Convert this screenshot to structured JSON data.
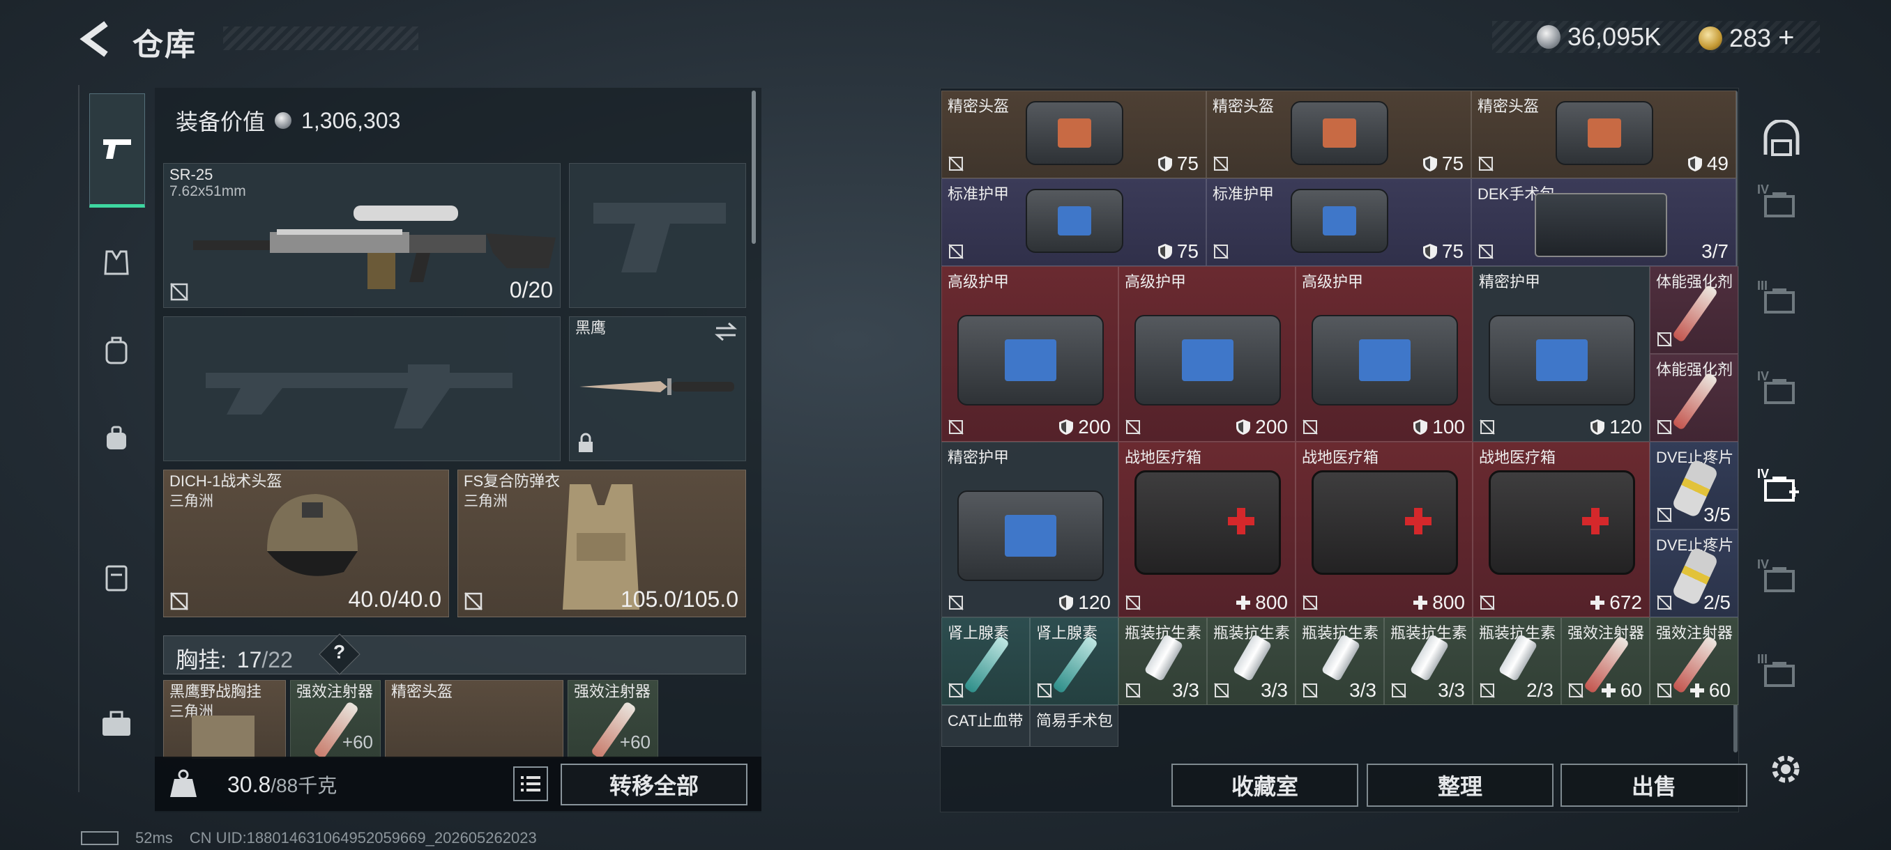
{
  "header": {
    "title": "仓库",
    "currency_silver": "36,095K",
    "currency_gold": "283",
    "gold_plus": "+"
  },
  "equipment": {
    "value_label": "装备价值",
    "value": "1,306,303"
  },
  "slots": {
    "primary": {
      "name": "SR-25",
      "caliber": "7.62x51mm",
      "ammo": "0/20"
    },
    "melee": {
      "name": "黑鹰"
    },
    "helmet": {
      "name": "DICH-1战术头盔",
      "brand": "三角洲",
      "durability": "40.0/40.0"
    },
    "armor": {
      "name": "FS复合防弹衣",
      "brand": "三角洲",
      "durability": "105.0/105.0"
    }
  },
  "chest_rig": {
    "label": "胸挂:",
    "used": "17",
    "capacity": "/22",
    "help": "?",
    "items": [
      {
        "name": "黑鹰野战胸挂",
        "brand": "三角洲"
      },
      {
        "name": "强效注射器",
        "value": "60"
      },
      {
        "name": "精密头盔"
      },
      {
        "name": "强效注射器",
        "value": "60"
      }
    ]
  },
  "bottom_left": {
    "weight": "30.8",
    "weight_max": "/88千克",
    "transfer_all": "转移全部"
  },
  "status": {
    "ping": "52ms",
    "uid": "CN UID:18801463106495205966​9_202605262023"
  },
  "storage_items": [
    {
      "name": "精密头盔",
      "value": "75"
    },
    {
      "name": "精密头盔",
      "value": "75"
    },
    {
      "name": "精密头盔",
      "value": "49"
    },
    {
      "name": "标准护甲",
      "value": "75"
    },
    {
      "name": "标准护甲",
      "value": "75"
    },
    {
      "name": "DEK手术包",
      "value": "3/7"
    },
    {
      "name": "高级护甲",
      "value": "200"
    },
    {
      "name": "高级护甲",
      "value": "200"
    },
    {
      "name": "高级护甲",
      "value": "100"
    },
    {
      "name": "精密护甲",
      "value": "120"
    },
    {
      "name": "体能强化剂",
      "value": ""
    },
    {
      "name": "体能强化剂",
      "value": ""
    },
    {
      "name": "精密护甲",
      "value": "120"
    },
    {
      "name": "战地医疗箱",
      "value": "800"
    },
    {
      "name": "战地医疗箱",
      "value": "800"
    },
    {
      "name": "战地医疗箱",
      "value": "672"
    },
    {
      "name": "DVE止疼片",
      "value": "3/5"
    },
    {
      "name": "DVE止疼片",
      "value": "2/5"
    },
    {
      "name": "肾上腺素",
      "value": ""
    },
    {
      "name": "肾上腺素",
      "value": ""
    },
    {
      "name": "瓶装抗生素",
      "value": "3/3"
    },
    {
      "name": "瓶装抗生素",
      "value": "3/3"
    },
    {
      "name": "瓶装抗生素",
      "value": "3/3"
    },
    {
      "name": "瓶装抗生素",
      "value": "3/3"
    },
    {
      "name": "瓶装抗生素",
      "value": "2/3"
    },
    {
      "name": "强效注射器",
      "value": "60"
    },
    {
      "name": "强效注射器",
      "value": "60"
    },
    {
      "name": "CAT止血带",
      "value": ""
    },
    {
      "name": "简易手术包",
      "value": ""
    }
  ],
  "actions": {
    "collection": "收藏室",
    "sort": "整理",
    "sell": "出售"
  },
  "side_tabs": [
    "IV",
    "III",
    "IV",
    "IV",
    "IV",
    "III"
  ],
  "colors": {
    "accent_green": "#3ed7a0",
    "red_rarity": "#6a2a30",
    "purple_rarity": "#3b3b58",
    "teal_rarity": "#2d4d4f"
  }
}
